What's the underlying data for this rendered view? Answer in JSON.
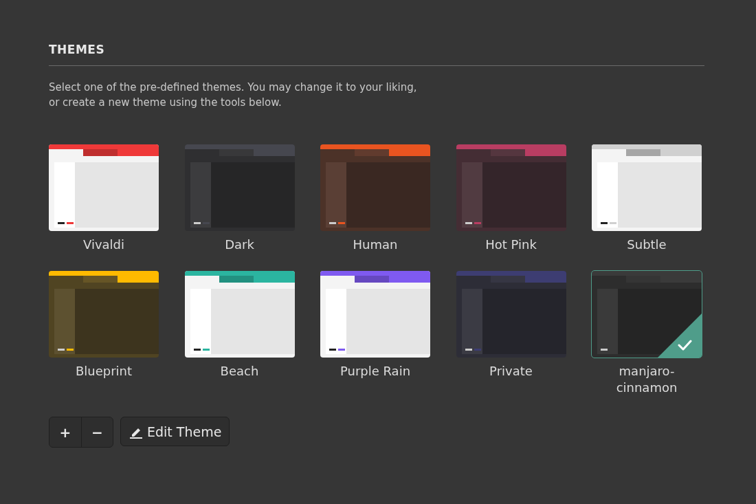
{
  "section": {
    "title": "THEMES",
    "description": "Select one of the pre-defined themes. You may change it to your liking,\nor create a new theme using the tools below."
  },
  "themes": [
    {
      "name": "Vivaldi",
      "selected": false,
      "kind": "light",
      "color": "#ef3939"
    },
    {
      "name": "Dark",
      "selected": false,
      "kind": "dark",
      "color": "#46474f"
    },
    {
      "name": "Human",
      "selected": false,
      "kind": "dark",
      "color": "#e95420"
    },
    {
      "name": "Hot Pink",
      "selected": false,
      "kind": "dark",
      "color": "#b93d62"
    },
    {
      "name": "Subtle",
      "selected": false,
      "kind": "light",
      "color": "#d0d0d0"
    },
    {
      "name": "Blueprint",
      "selected": false,
      "kind": "dark",
      "color": "#ffba00"
    },
    {
      "name": "Beach",
      "selected": false,
      "kind": "light",
      "color": "#2bb5a0"
    },
    {
      "name": "Purple Rain",
      "selected": false,
      "kind": "light",
      "color": "#7f5af0"
    },
    {
      "name": "Private",
      "selected": false,
      "kind": "dark",
      "color": "#3d3d72"
    },
    {
      "name": "manjaro-cinnamon",
      "selected": true,
      "kind": "dark",
      "color": "#3a3a3a"
    }
  ],
  "toolbar": {
    "add_button": "+",
    "remove_button": "−",
    "edit_button": "Edit Theme"
  }
}
